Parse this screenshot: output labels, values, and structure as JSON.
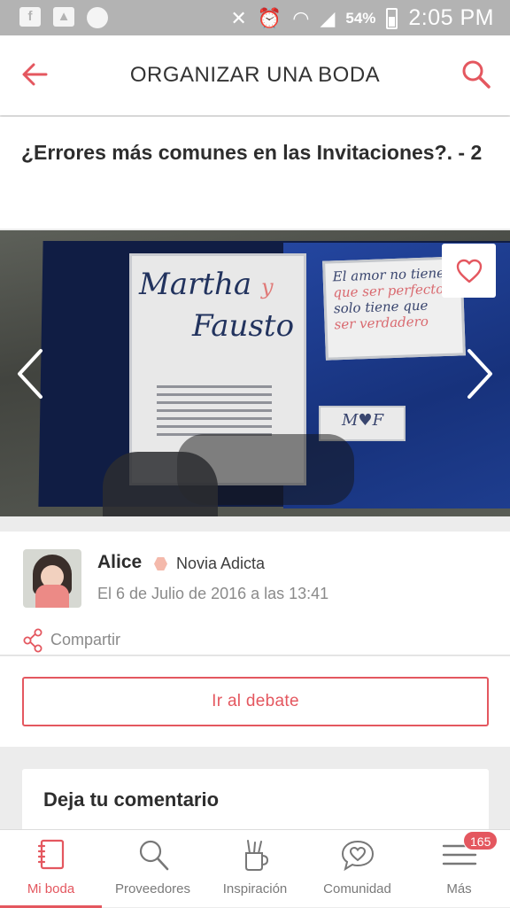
{
  "status_bar": {
    "battery_percent": "54%",
    "time": "2:05 PM"
  },
  "header": {
    "title": "ORGANIZAR UNA BODA"
  },
  "post": {
    "title": "¿Errores más comunes en las Invitaciones?. - 2"
  },
  "photo": {
    "names_line1": "Martha",
    "names_amp": "y",
    "names_line2": "Fausto",
    "quote_line1": "El amor no tiene",
    "quote_line2": "que ser perfecto",
    "quote_line3": "solo tiene que",
    "quote_line4": "ser verdadero"
  },
  "author": {
    "name": "Alice",
    "rank": "Novia Adicta",
    "date": "El 6 de Julio de 2016 a las 13:41",
    "share_label": "Compartir"
  },
  "actions": {
    "debate_button": "Ir al debate"
  },
  "comment": {
    "label": "Deja tu comentario"
  },
  "bottom_nav": {
    "items": [
      {
        "label": "Mi boda",
        "icon": "notebook-icon"
      },
      {
        "label": "Proveedores",
        "icon": "search-icon"
      },
      {
        "label": "Inspiración",
        "icon": "pencil-cup-icon"
      },
      {
        "label": "Comunidad",
        "icon": "chat-heart-icon"
      },
      {
        "label": "Más",
        "icon": "menu-icon"
      }
    ],
    "badge": "165"
  },
  "colors": {
    "accent": "#e4575f",
    "status_bar": "#b3b3b3"
  }
}
